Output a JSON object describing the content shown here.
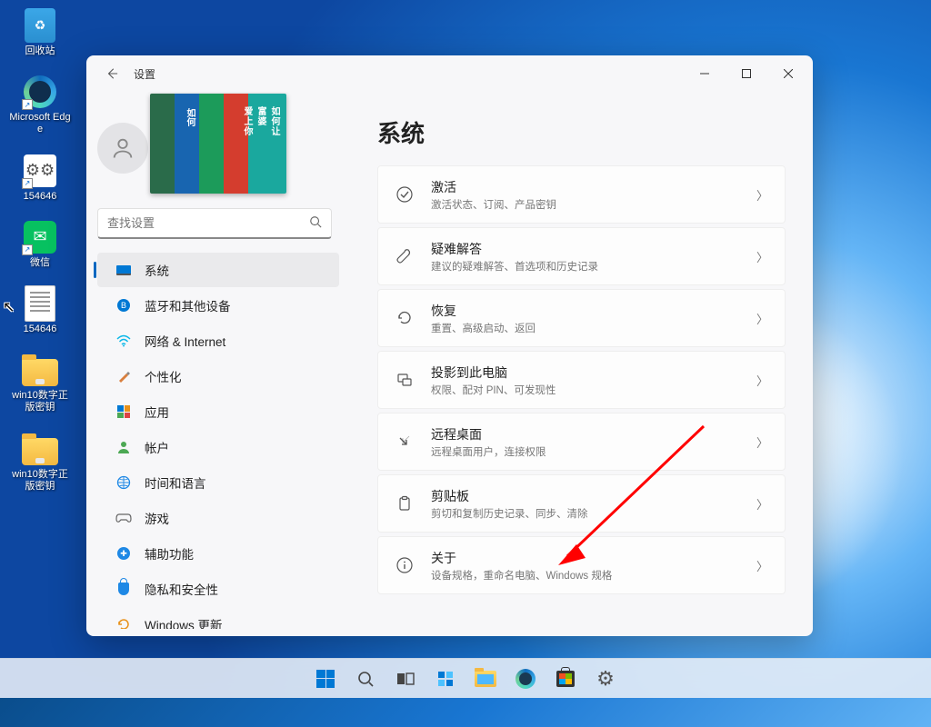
{
  "desktop": {
    "icons": [
      {
        "label": "回收站",
        "name": "recycle-bin"
      },
      {
        "label": "Microsoft Edge",
        "name": "edge"
      },
      {
        "label": "154646",
        "name": "file-154646-1"
      },
      {
        "label": "微信",
        "name": "wechat"
      },
      {
        "label": "154646",
        "name": "file-154646-2"
      },
      {
        "label": "win10数字正版密钥",
        "name": "folder-win10-key-1"
      },
      {
        "label": "win10数字正版密钥",
        "name": "folder-win10-key-2"
      }
    ]
  },
  "window": {
    "title": "设置",
    "search_placeholder": "查找设置",
    "page_heading": "系统",
    "nav": [
      {
        "label": "系统",
        "active": true
      },
      {
        "label": "蓝牙和其他设备"
      },
      {
        "label": "网络 & Internet"
      },
      {
        "label": "个性化"
      },
      {
        "label": "应用"
      },
      {
        "label": "帐户"
      },
      {
        "label": "时间和语言"
      },
      {
        "label": "游戏"
      },
      {
        "label": "辅助功能"
      },
      {
        "label": "隐私和安全性"
      },
      {
        "label": "Windows 更新"
      }
    ],
    "rows": [
      {
        "title": "激活",
        "desc": "激活状态、订阅、产品密钥"
      },
      {
        "title": "疑难解答",
        "desc": "建议的疑难解答、首选项和历史记录"
      },
      {
        "title": "恢复",
        "desc": "重置、高级启动、返回"
      },
      {
        "title": "投影到此电脑",
        "desc": "权限、配对 PIN、可发现性"
      },
      {
        "title": "远程桌面",
        "desc": "远程桌面用户，连接权限"
      },
      {
        "title": "剪贴板",
        "desc": "剪切和复制历史记录、同步、清除"
      },
      {
        "title": "关于",
        "desc": "设备规格，重命名电脑、Windows 规格"
      }
    ]
  }
}
